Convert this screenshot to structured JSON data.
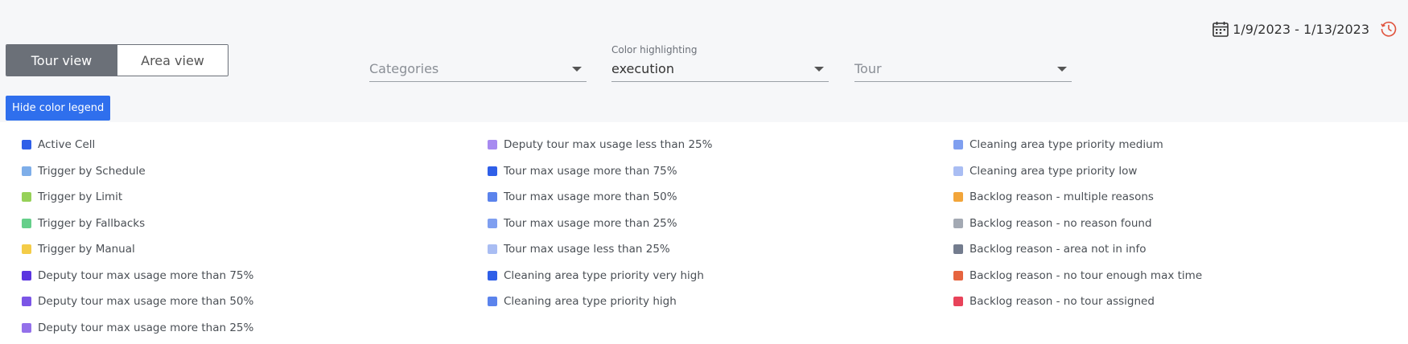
{
  "view_toggle": {
    "tour_label": "Tour view",
    "area_label": "Area view",
    "active": "tour"
  },
  "filters": {
    "categories": {
      "label": "",
      "value": "Categories"
    },
    "color_highlighting": {
      "label": "Color highlighting",
      "value": "execution"
    },
    "tour": {
      "label": "",
      "value": "Tour"
    }
  },
  "date_range": {
    "text": "1/9/2023 - 1/13/2023",
    "calendar_icon": "calendar-icon",
    "history_icon": "clock-history-icon",
    "history_color": "#e0533d"
  },
  "legend_button": {
    "label": "Hide color legend",
    "color": "#2f6fed"
  },
  "legend": {
    "columns": [
      [
        {
          "label": "Active Cell",
          "color": "#2f5fe8"
        },
        {
          "label": "Trigger by Schedule",
          "color": "#7eaee9"
        },
        {
          "label": "Trigger by Limit",
          "color": "#96d158"
        },
        {
          "label": "Trigger by Fallbacks",
          "color": "#65cf8a"
        },
        {
          "label": "Trigger by Manual",
          "color": "#f4cc48"
        },
        {
          "label": "Deputy tour max usage more than 75%",
          "color": "#5b35e0"
        },
        {
          "label": "Deputy tour max usage more than 50%",
          "color": "#7b55e6"
        },
        {
          "label": "Deputy tour max usage more than 25%",
          "color": "#9370ea"
        }
      ],
      [
        {
          "label": "Deputy tour max usage less than 25%",
          "color": "#a78af0"
        },
        {
          "label": "Tour max usage more than 75%",
          "color": "#2f5fe8"
        },
        {
          "label": "Tour max usage more than 50%",
          "color": "#5b83ec"
        },
        {
          "label": "Tour max usage more than 25%",
          "color": "#7f9ff0"
        },
        {
          "label": "Tour max usage less than 25%",
          "color": "#a9bdf3"
        },
        {
          "label": "Cleaning area type priority very high",
          "color": "#2f5fe8"
        },
        {
          "label": "Cleaning area type priority high",
          "color": "#5b83ec"
        }
      ],
      [
        {
          "label": "Cleaning area type priority medium",
          "color": "#7f9ff0"
        },
        {
          "label": "Cleaning area type priority low",
          "color": "#a9bdf3"
        },
        {
          "label": "Backlog reason - multiple reasons",
          "color": "#f2a53a"
        },
        {
          "label": "Backlog reason - no reason found",
          "color": "#a3a9b3"
        },
        {
          "label": "Backlog reason - area not in info",
          "color": "#737c8e"
        },
        {
          "label": "Backlog reason - no tour enough max time",
          "color": "#e6643f"
        },
        {
          "label": "Backlog reason - no tour assigned",
          "color": "#e8435a"
        }
      ]
    ]
  }
}
